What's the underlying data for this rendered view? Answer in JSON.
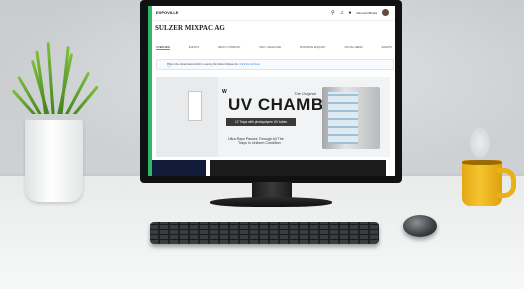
{
  "screen": {
    "brand": "EXPOVILLE",
    "company_name": "SULZER MIXPAC AG",
    "user_name": "Ramesh Bhatia",
    "tabs": [
      "OVERVIEW",
      "EVENTS",
      "ABOUT COMPANY",
      "INFO / SELECTED",
      "BUSINESS ENQUIRY",
      "SOCIAL MEDIA",
      "EVENTS"
    ],
    "notice": "This is the virtual stand which is owning the Sulzer Mixpac AG.",
    "notice_link": "Click the link here",
    "banner": {
      "brand_mark": "W",
      "tagline": "The Original",
      "title": "UV CHAMBER",
      "subtitle": "12 Trays with photopolyme UV tubes",
      "feature_line1": "Ultra Rays Passes Through All The",
      "feature_line2": "Trays In Uniform Condition"
    }
  },
  "icons": [
    "search-icon",
    "bell-icon",
    "user-icon"
  ],
  "colors": {
    "accent": "#2fb66b",
    "mug": "#f2bd2a"
  }
}
